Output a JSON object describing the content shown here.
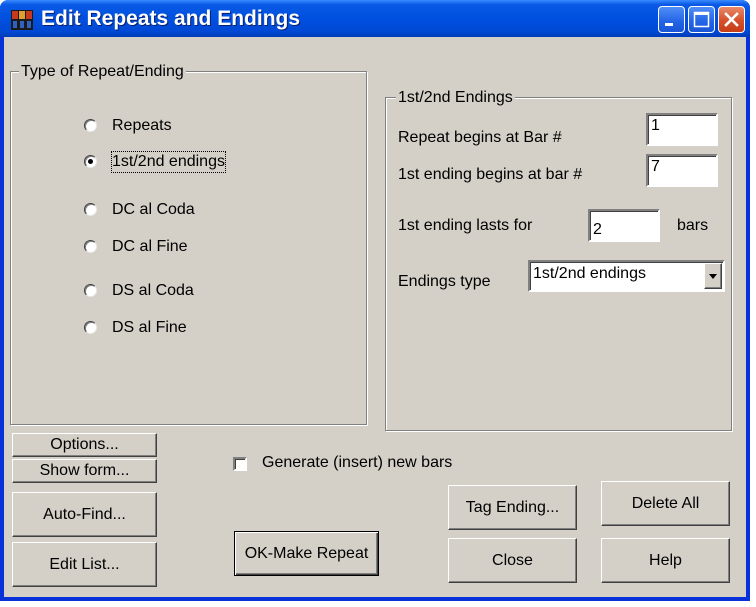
{
  "window": {
    "title": "Edit Repeats and Endings",
    "icon": "band-in-a-box-app-icon",
    "controls": [
      "minimize-icon",
      "maximize-icon",
      "close-icon"
    ]
  },
  "type_group": {
    "legend": "Type of Repeat/Ending",
    "options": [
      {
        "label": "Repeats",
        "selected": false
      },
      {
        "label": "1st/2nd endings",
        "selected": true
      },
      {
        "label": "DC al Coda",
        "selected": false
      },
      {
        "label": "DC al Fine",
        "selected": false
      },
      {
        "label": "DS al Coda",
        "selected": false
      },
      {
        "label": "DS al Fine",
        "selected": false
      }
    ]
  },
  "endings_group": {
    "legend": "1st/2nd Endings",
    "repeat_begins_label": "Repeat begins at Bar #",
    "repeat_begins_value": "1",
    "first_ending_begins_label": "1st ending begins at bar #",
    "first_ending_begins_value": "7",
    "first_ending_lasts_label": "1st ending lasts for",
    "first_ending_lasts_value": "2",
    "bars_label": "bars",
    "endings_type_label": "Endings type",
    "endings_type_value": "1st/2nd endings"
  },
  "generate_checkbox": {
    "label": "Generate (insert) new bars",
    "checked": false
  },
  "buttons": {
    "options": "Options...",
    "show_form": "Show form...",
    "auto_find": "Auto-Find...",
    "edit_list": "Edit List...",
    "ok_make_repeat": "OK-Make Repeat",
    "tag_ending": "Tag Ending...",
    "delete_all": "Delete All",
    "close": "Close",
    "help": "Help"
  }
}
